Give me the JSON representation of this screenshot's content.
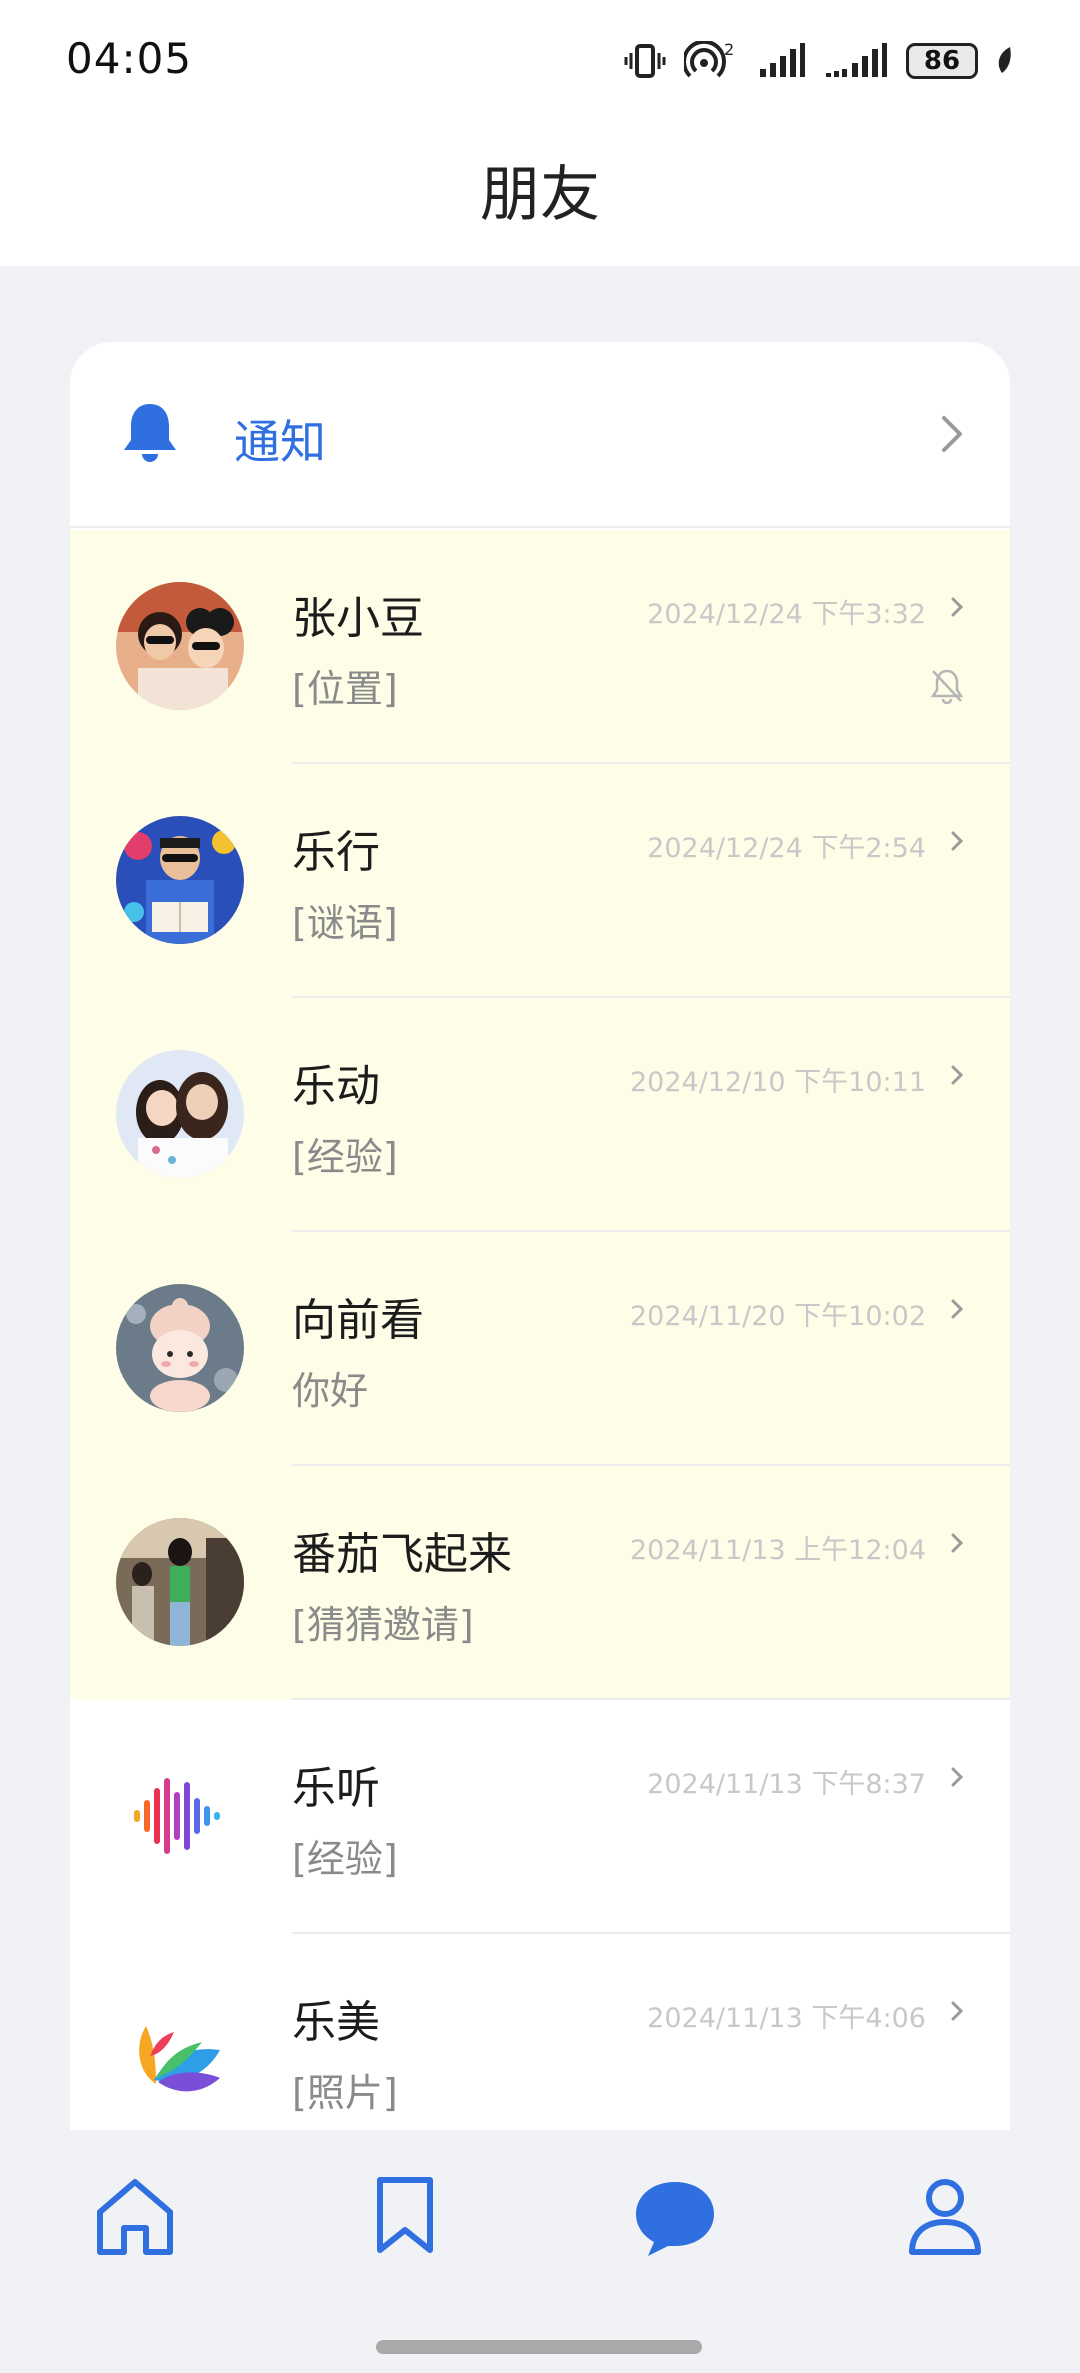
{
  "status_bar": {
    "time": "04:05",
    "battery": "86",
    "icons": [
      "vibrate-icon",
      "hotspot-icon",
      "signal-icon",
      "signal-icon",
      "battery-icon",
      "leaf-icon"
    ]
  },
  "header": {
    "title": "朋友"
  },
  "notice": {
    "label": "通知",
    "icon": "bell-icon"
  },
  "friends": [
    {
      "name": "张小豆",
      "time": "2024/12/24 下午3:32",
      "preview": "[位置]",
      "highlight": true,
      "muted": true
    },
    {
      "name": "乐行",
      "time": "2024/12/24 下午2:54",
      "preview": "[谜语]",
      "highlight": true
    },
    {
      "name": "乐动",
      "time": "2024/12/10 下午10:11",
      "preview": "[经验]",
      "highlight": true
    },
    {
      "name": "向前看",
      "time": "2024/11/20 下午10:02",
      "preview": "你好",
      "highlight": true
    },
    {
      "name": "番茄飞起来",
      "time": "2024/11/13 上午12:04",
      "preview": "[猜猜邀请]",
      "highlight": true
    },
    {
      "name": "乐听",
      "time": "2024/11/13 下午8:37",
      "preview": "[经验]",
      "highlight": false
    },
    {
      "name": "乐美",
      "time": "2024/11/13 下午4:06",
      "preview": "[照片]",
      "highlight": false
    }
  ],
  "bottom_nav": {
    "items": [
      "home-icon",
      "bookmark-icon",
      "chat-icon",
      "profile-icon"
    ],
    "active": "chat-icon"
  },
  "colors": {
    "accent": "#2f6fe0",
    "highlight_row": "#fefee8",
    "background": "#f1f2f6"
  }
}
